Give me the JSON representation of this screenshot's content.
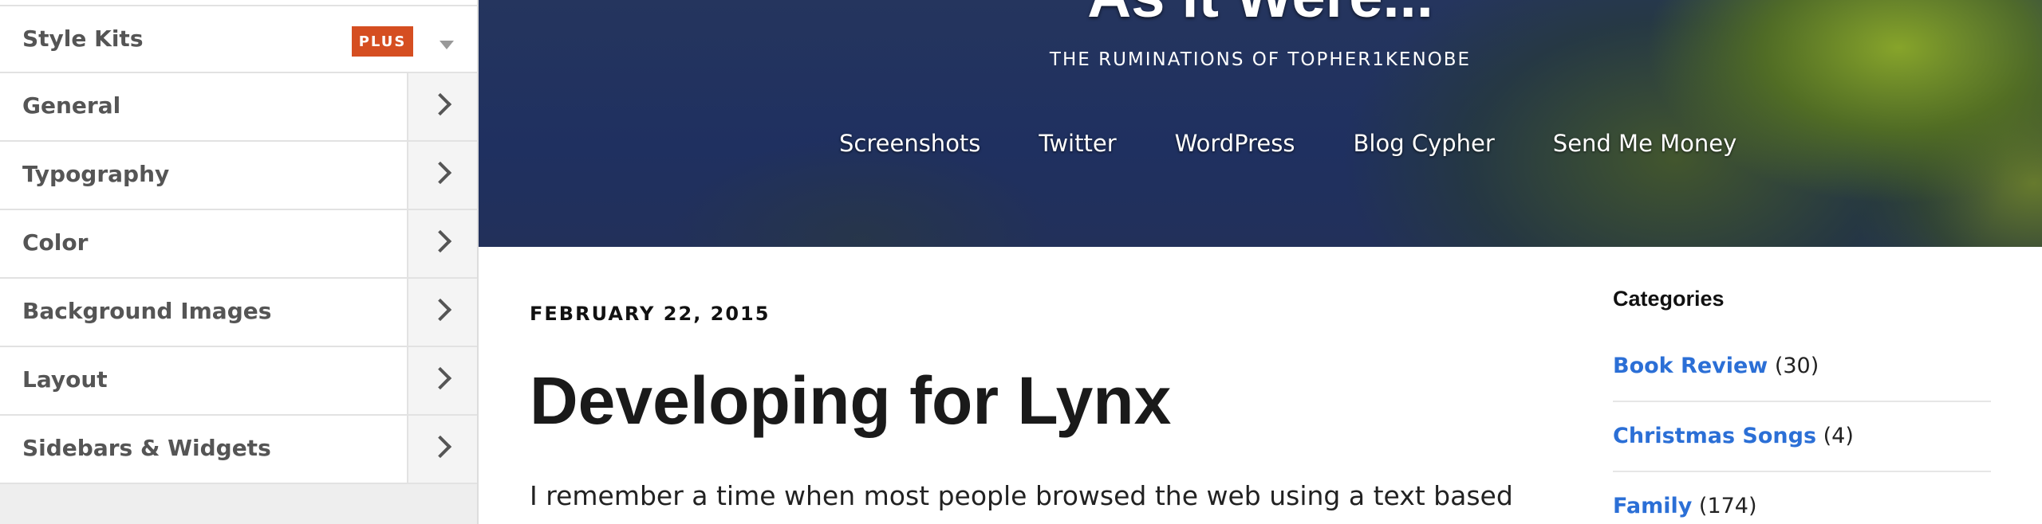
{
  "customizer": {
    "style_kits": {
      "label": "Style Kits",
      "badge": "PLUS"
    },
    "sections": [
      {
        "label": "General",
        "icon": "chevron-right-icon"
      },
      {
        "label": "Typography",
        "icon": "chevron-right-icon"
      },
      {
        "label": "Color",
        "icon": "chevron-right-icon"
      },
      {
        "label": "Background Images",
        "icon": "chevron-right-icon"
      },
      {
        "label": "Layout",
        "icon": "chevron-right-icon"
      },
      {
        "label": "Sidebars & Widgets",
        "icon": "chevron-right-icon"
      }
    ],
    "colors": {
      "badge_bg": "#d54e21",
      "label": "#555555"
    }
  },
  "header": {
    "site_title": "As it Were...",
    "tagline": "THE RUMINATIONS OF TOPHER1KENOBE",
    "nav": [
      "Screenshots",
      "Twitter",
      "WordPress",
      "Blog Cypher",
      "Send Me Money"
    ]
  },
  "post": {
    "date": "FEBRUARY 22, 2015",
    "title": "Developing for Lynx",
    "excerpt": "I remember a time when most people browsed the web using a text based"
  },
  "sidebar": {
    "widget_title": "Categories",
    "categories": [
      {
        "name": "Book Review",
        "count": "(30)"
      },
      {
        "name": "Christmas Songs",
        "count": "(4)"
      },
      {
        "name": "Family",
        "count": "(174)"
      }
    ],
    "link_color": "#2b6fd6"
  }
}
